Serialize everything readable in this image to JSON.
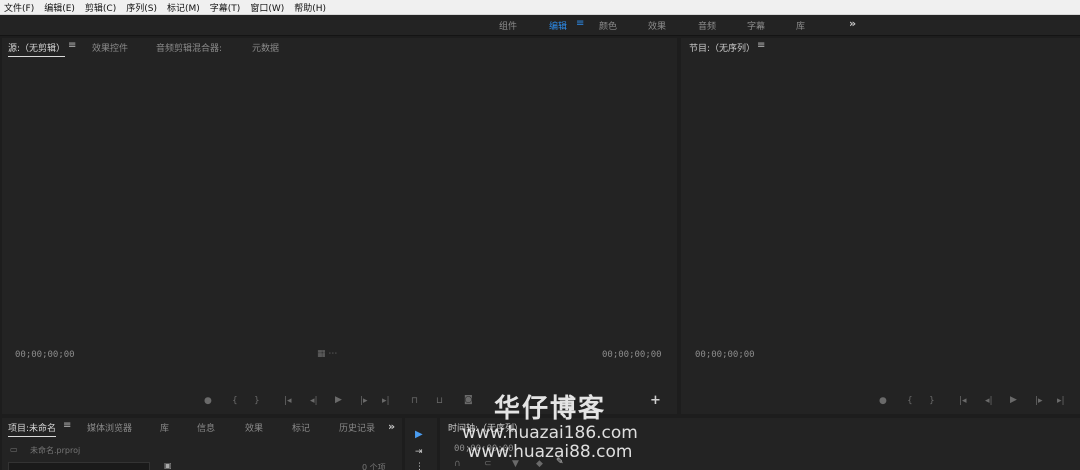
{
  "menubar": {
    "items": [
      "文件(F)",
      "编辑(E)",
      "剪辑(C)",
      "序列(S)",
      "标记(M)",
      "字幕(T)",
      "窗口(W)",
      "帮助(H)"
    ]
  },
  "workspaces": {
    "items": [
      "组件",
      "编辑",
      "颜色",
      "效果",
      "音频",
      "字幕",
      "库"
    ],
    "active": "编辑",
    "menu_icon": "≡",
    "more_icon": "»"
  },
  "source_panel": {
    "tabs": [
      "源:（无剪辑）",
      "效果控件",
      "音频剪辑混合器:",
      "元数据"
    ],
    "menu_icon": "≡",
    "timecode_left": "00;00;00;00",
    "timecode_right": "00;00;00;00",
    "add_icon": "+"
  },
  "program_panel": {
    "title": "节目:（无序列）",
    "menu_icon": "≡",
    "timecode": "00;00;00;00"
  },
  "project_panel": {
    "tabs": [
      "项目:未命名",
      "媒体浏览器",
      "库",
      "信息",
      "效果",
      "标记",
      "历史记录"
    ],
    "menu_icon": "≡",
    "more_icon": "»",
    "file_name": "未命名.prproj",
    "item_count": "0 个项"
  },
  "timeline_panel": {
    "tab": "时间轴:（无序列）",
    "timecode": "00;00;00;00"
  },
  "watermark": {
    "title": "华仔博客",
    "url1": "www.huazai186.com",
    "url2": "www.huazai88.com"
  },
  "colors": {
    "accent": "#2d8ceb",
    "panel_bg": "#232323",
    "app_bg": "#1d1d1d"
  }
}
